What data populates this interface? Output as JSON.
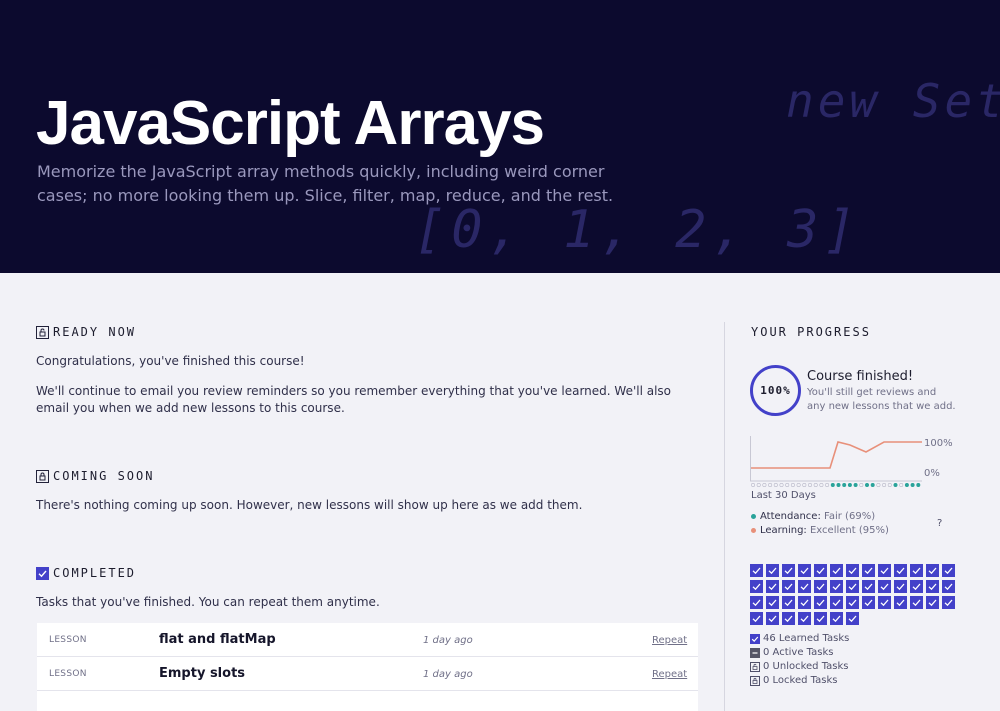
{
  "hero": {
    "title": "JavaScript Arrays",
    "subtitle": "Memorize the JavaScript array methods quickly, including weird corner cases; no more looking them up. Slice, filter, map, reduce, and the rest.",
    "deco_top": "new Set",
    "deco_bottom": "[0, 1, 2, 3]"
  },
  "ready": {
    "title": "READY NOW",
    "icon": "unlocked-icon",
    "line1": "Congratulations, you've finished this course!",
    "line2": "We'll continue to email you review reminders so you remember everything that you've learned. We'll also email you when we add new lessons to this course."
  },
  "coming": {
    "title": "COMING SOON",
    "icon": "lock-icon",
    "line1": "There's nothing coming up soon. However, new lessons will show up here as we add them."
  },
  "completed": {
    "title": "COMPLETED",
    "icon": "checkbox-icon",
    "line1": "Tasks that you've finished. You can repeat them anytime.",
    "rows": [
      {
        "type": "LESSON",
        "name": "flat and flatMap",
        "time": "1 day ago",
        "action": "Repeat"
      },
      {
        "type": "LESSON",
        "name": "Empty slots",
        "time": "1 day ago",
        "action": "Repeat"
      }
    ]
  },
  "progress": {
    "title": "YOUR PROGRESS",
    "percent": "100%",
    "finished_title": "Course finished!",
    "finished_sub": "You'll still get reviews and any new lessons that we add.",
    "chart_top_label": "100%",
    "chart_bottom_label": "0%",
    "chart_period": "Last 30 Days",
    "attendance_label": "Attendance:",
    "attendance_value": "Fair (69%)",
    "learning_label": "Learning:",
    "learning_value": "Excellent (95%)",
    "help": "?",
    "learned": "46 Learned Tasks",
    "active": "0 Active Tasks",
    "unlocked": "0 Unlocked Tasks",
    "locked": "0 Locked Tasks",
    "learned_count": 46,
    "colors": {
      "accent": "#4341c9",
      "learning": "#e8907a",
      "attendance": "#2aa39a",
      "hero_bg": "#0c0a2e"
    }
  }
}
